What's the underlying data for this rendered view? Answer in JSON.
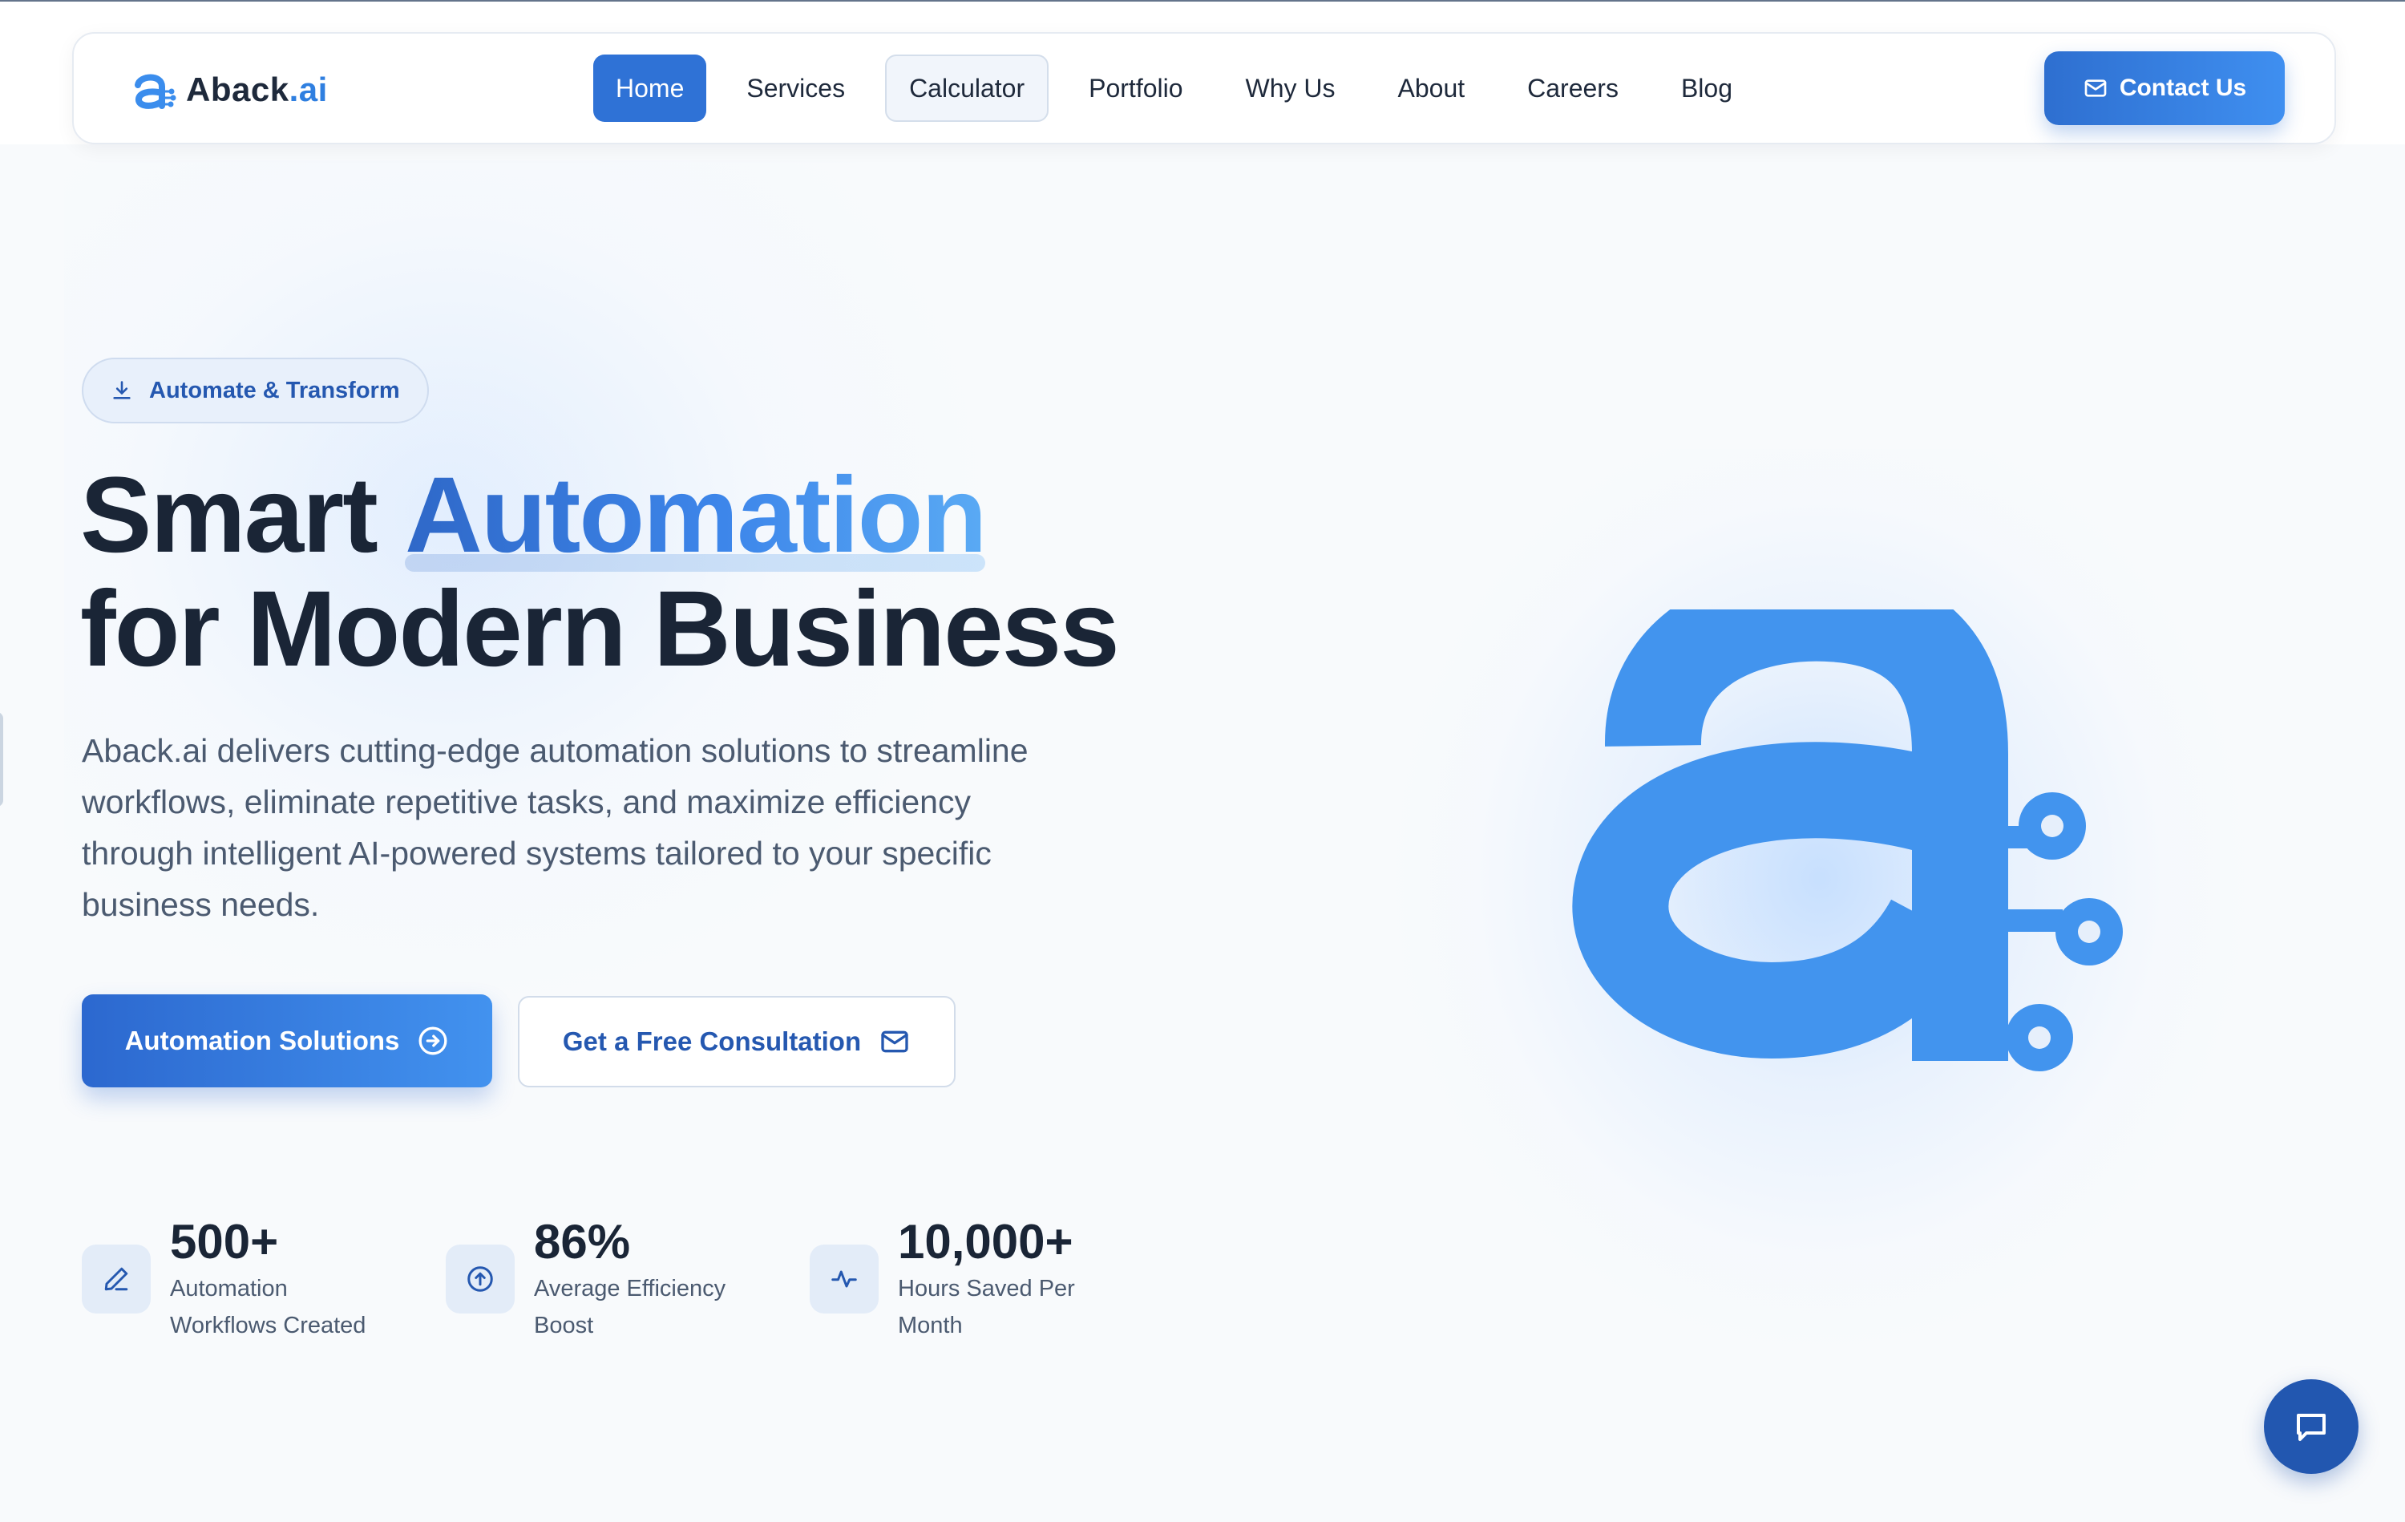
{
  "brand": {
    "name_main": "Aback",
    "name_suffix": ".ai"
  },
  "nav": {
    "items": [
      {
        "label": "Home",
        "state": "active"
      },
      {
        "label": "Services",
        "state": "default"
      },
      {
        "label": "Calculator",
        "state": "outlined"
      },
      {
        "label": "Portfolio",
        "state": "default"
      },
      {
        "label": "Why Us",
        "state": "default"
      },
      {
        "label": "About",
        "state": "default"
      },
      {
        "label": "Careers",
        "state": "default"
      },
      {
        "label": "Blog",
        "state": "default"
      }
    ],
    "contact_label": "Contact Us"
  },
  "hero": {
    "pill_label": "Automate & Transform",
    "headline_prefix": "Smart ",
    "headline_accent": "Automation",
    "headline_line2": "for Modern Business",
    "description": "Aback.ai delivers cutting-edge automation solutions to streamline workflows, eliminate repetitive tasks, and maximize efficiency through intelligent AI-powered systems tailored to your specific business needs.",
    "primary_cta": "Automation Solutions",
    "secondary_cta": "Get a Free Consultation"
  },
  "stats": [
    {
      "value": "500+",
      "label": "Automation Workflows Created",
      "icon": "pencil-icon"
    },
    {
      "value": "86%",
      "label": "Average Efficiency Boost",
      "icon": "arrow-up-circle-icon"
    },
    {
      "value": "10,000+",
      "label": "Hours Saved Per Month",
      "icon": "activity-icon"
    }
  ],
  "icons": {
    "logo": "aback-logo-icon",
    "contact": "mail-icon",
    "pill": "download-icon",
    "primary_cta": "arrow-right-circle-icon",
    "secondary_cta": "mail-icon",
    "chat": "chat-icon"
  },
  "colors": {
    "primary": "#2f72d6",
    "accent_blue": "#4294ee",
    "heading": "#1a2536",
    "body_text": "#4b5a70",
    "background": "#f8fafc",
    "chat_button": "#2257b0"
  }
}
